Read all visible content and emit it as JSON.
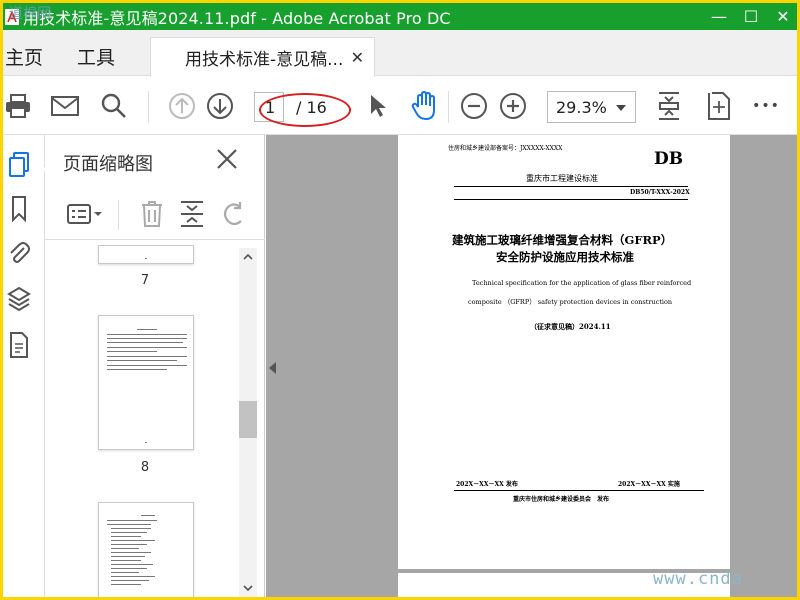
{
  "window": {
    "title": "用技术标准-意见稿2024.11.pdf - Adobe Acrobat Pro DC",
    "controls": [
      "—",
      "☐",
      "✕"
    ]
  },
  "watermark_logo": "道棉网",
  "tabs": {
    "home": "主页",
    "tools": "工具",
    "document": "用技术标准-意见稿...",
    "close": "✕"
  },
  "toolbar": {
    "page_current": "1",
    "page_total": "/ 16",
    "zoom": "29.3%",
    "more": "•••"
  },
  "thumbnail_panel": {
    "title": "页面缩略图",
    "thumbnails": [
      {
        "label": "7"
      },
      {
        "label": "8"
      }
    ]
  },
  "page": {
    "record_line": "住房和城乡建设部备案号：JXXXXX-XXXX",
    "db_mark": "DB",
    "issuer_line": "重庆市工程建设标准",
    "std_number": "DB50/T-XXX-202X",
    "title_cn_1": "建筑施工玻璃纤维增强复合材料（GFRP）",
    "title_cn_2": "安全防护设施应用技术标准",
    "title_en_1": "Technical specification for the application of glass fiber reinforced",
    "title_en_2": "composite （GFRP） safety protection devices in construction",
    "draft": "（征求意见稿）2024.11",
    "release": "202X－XX－XX 发布",
    "implement": "202X－XX－XX 实施",
    "publisher": "重庆市住房和城乡建设委员会　发布"
  },
  "site_watermark": "www.cnda",
  "colors": {
    "titlebar": "#18a02e",
    "highlight_ellipse": "#d42020",
    "active_icon": "#1473e6",
    "frame": "#ffd400"
  }
}
